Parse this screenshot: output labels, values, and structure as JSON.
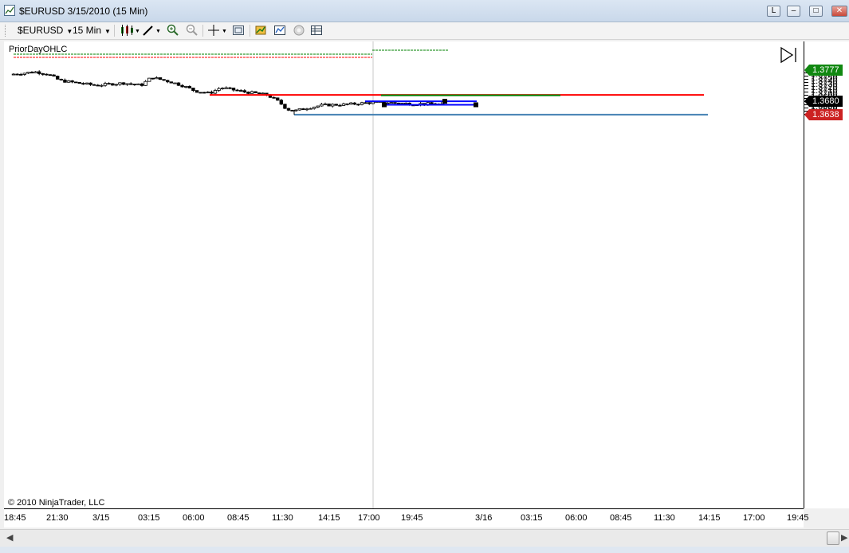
{
  "window": {
    "title": "$EURUSD  3/15/2010 (15 Min)",
    "buttons": {
      "lock": "L",
      "minimize": "–",
      "maximize": "□",
      "close": "✕"
    }
  },
  "toolbar": {
    "instrument": "$EURUSD",
    "interval": "15 Min"
  },
  "chart": {
    "indicator_label": "PriorDayOHLC",
    "copyright": "© 2010 NinjaTrader, LLC",
    "colors": {
      "up": "#ffffff",
      "down": "#000000",
      "prior_close": "#ff0000",
      "prior_open": "#008000",
      "prior_low": "#4682b4",
      "box": "#0000ff"
    },
    "y_axis": {
      "labels": [
        "1.3770",
        "1.3760",
        "1.3750",
        "1.3740",
        "1.3730",
        "1.3720",
        "1.3710",
        "1.3700",
        "1.3690",
        "1.3680",
        "1.3670",
        "1.3660",
        "1.3650",
        "1.3640"
      ],
      "high_tag": "1.3777",
      "last_tag": "1.3680",
      "low_tag": "1.3638"
    },
    "x_axis": {
      "labels": [
        "18:45",
        "21:30",
        "3/15",
        "03:15",
        "06:00",
        "08:45",
        "11:30",
        "14:15",
        "17:00",
        "19:45",
        "3/16",
        "03:15",
        "06:00",
        "08:45",
        "11:30",
        "14:15",
        "17:00",
        "19:45"
      ]
    }
  }
}
